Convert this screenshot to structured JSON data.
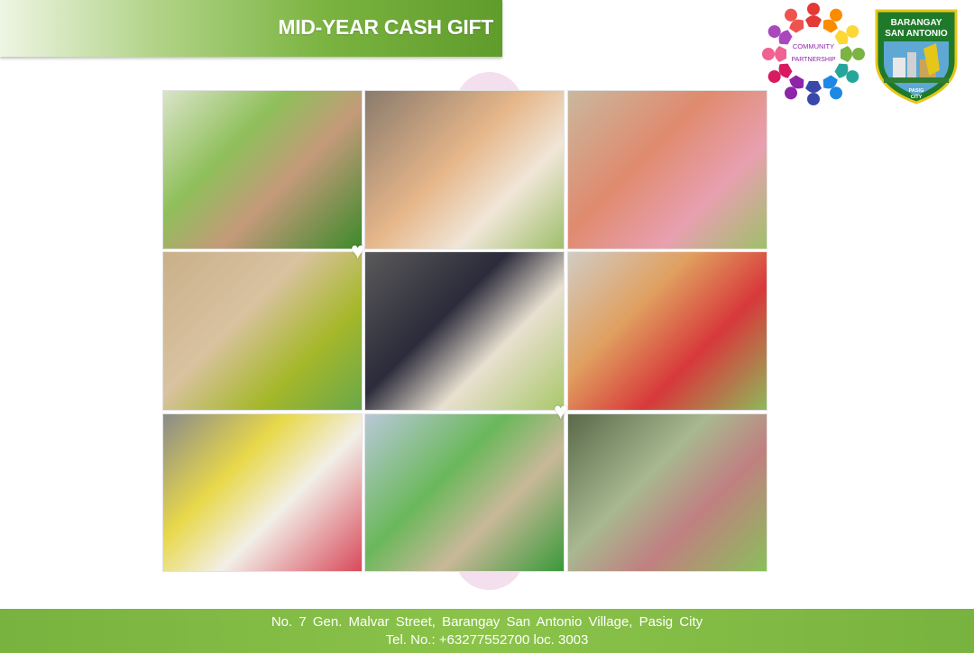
{
  "header": {
    "title": "MID-YEAR CASH GIFT"
  },
  "logos": {
    "community": {
      "icon": "community-partnership-logo",
      "text": "COMMUNITY PARTNERSHIP"
    },
    "barangay": {
      "icon": "barangay-seal-logo",
      "text_top": "BARANGAY",
      "text_mid": "SAN ANTONIO",
      "text_bottom": "PASIG CITY"
    }
  },
  "collage": {
    "photos": [
      {
        "desc": "photo-1"
      },
      {
        "desc": "photo-2"
      },
      {
        "desc": "photo-3"
      },
      {
        "desc": "photo-4"
      },
      {
        "desc": "photo-5"
      },
      {
        "desc": "photo-6"
      },
      {
        "desc": "photo-7"
      },
      {
        "desc": "photo-8"
      },
      {
        "desc": "photo-9"
      }
    ]
  },
  "footer": {
    "address": "No. 7 Gen. Malvar Street, Barangay San Antonio Village, Pasig City",
    "tel": "Tel. No.: +63277552700 loc. 3003"
  },
  "colors": {
    "brand_green": "#7ab33f",
    "dark_green": "#1e7a2a",
    "seal_gold": "#e6c619"
  }
}
